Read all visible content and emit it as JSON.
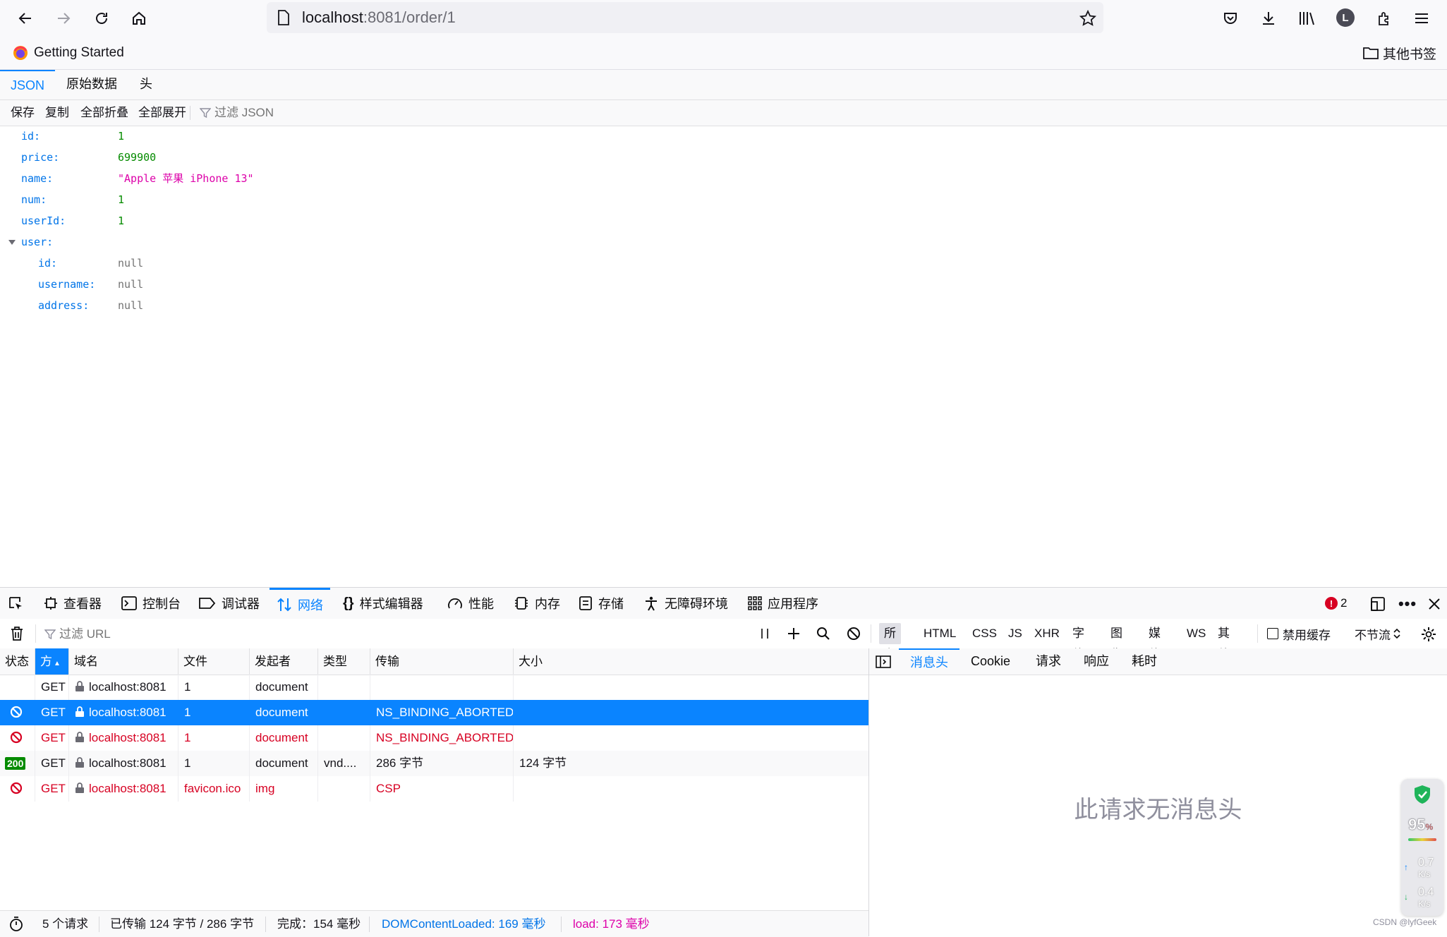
{
  "browser": {
    "url_host": "localhost",
    "url_rest": ":8081/order/1",
    "bookmark_label": "Getting Started",
    "other_bookmarks": "其他书签",
    "avatar_letter": "L"
  },
  "json_viewer": {
    "tabs": [
      "JSON",
      "原始数据",
      "头"
    ],
    "actions": [
      "保存",
      "复制",
      "全部折叠",
      "全部展开"
    ],
    "filter_placeholder": "过滤 JSON",
    "rows": [
      {
        "key": "id:",
        "value": "1"
      },
      {
        "key": "price:",
        "value": "699900"
      },
      {
        "key": "name:",
        "value": "\"Apple 苹果 iPhone 13\""
      },
      {
        "key": "num:",
        "value": "1"
      },
      {
        "key": "userId:",
        "value": "1"
      },
      {
        "key": "user:",
        "value": ""
      },
      {
        "key": "id:",
        "value": "null"
      },
      {
        "key": "username:",
        "value": "null"
      },
      {
        "key": "address:",
        "value": "null"
      }
    ]
  },
  "devtools": {
    "tools": [
      "查看器",
      "控制台",
      "调试器",
      "网络",
      "样式编辑器",
      "性能",
      "内存",
      "存储",
      "无障碍环境",
      "应用程序"
    ],
    "error_count": "2",
    "filter_url_placeholder": "过滤 URL",
    "type_filters": [
      "所有",
      "HTML",
      "CSS",
      "JS",
      "XHR",
      "字体",
      "图像",
      "媒体",
      "WS",
      "其他"
    ],
    "disable_cache": "禁用缓存",
    "throttle": "不节流",
    "columns": [
      "状态",
      "方",
      "域名",
      "文件",
      "发起者",
      "类型",
      "传输",
      "大小"
    ],
    "requests": [
      {
        "status": "",
        "method": "GET",
        "domain": "localhost:8081",
        "file": "1",
        "initiator": "document",
        "type": "",
        "transfer": "",
        "size": ""
      },
      {
        "status": "",
        "method": "GET",
        "domain": "localhost:8081",
        "file": "1",
        "initiator": "document",
        "type": "",
        "transfer": "NS_BINDING_ABORTED",
        "size": ""
      },
      {
        "status": "",
        "method": "GET",
        "domain": "localhost:8081",
        "file": "1",
        "initiator": "document",
        "type": "",
        "transfer": "NS_BINDING_ABORTED",
        "size": ""
      },
      {
        "status": "200",
        "method": "GET",
        "domain": "localhost:8081",
        "file": "1",
        "initiator": "document",
        "type": "vnd....",
        "transfer": "286 字节",
        "size": "124 字节"
      },
      {
        "status": "",
        "method": "GET",
        "domain": "localhost:8081",
        "file": "favicon.ico",
        "initiator": "img",
        "type": "",
        "transfer": "CSP",
        "size": ""
      }
    ],
    "status_bar": {
      "requests": "5 个请求",
      "transferred": "已传输 124 字节 / 286 字节",
      "finish": "完成：154 毫秒",
      "dom_loaded": "DOMContentLoaded: 169 毫秒",
      "load": "load: 173 毫秒"
    },
    "detail_tabs": [
      "消息头",
      "Cookie",
      "请求",
      "响应",
      "耗时"
    ],
    "no_headers": "此请求无消息头"
  },
  "widget": {
    "score": "95",
    "score_unit": "%",
    "up": "0.7",
    "down": "0.4",
    "unit": "K/s"
  },
  "watermark": "CSDN @lyfGeek"
}
